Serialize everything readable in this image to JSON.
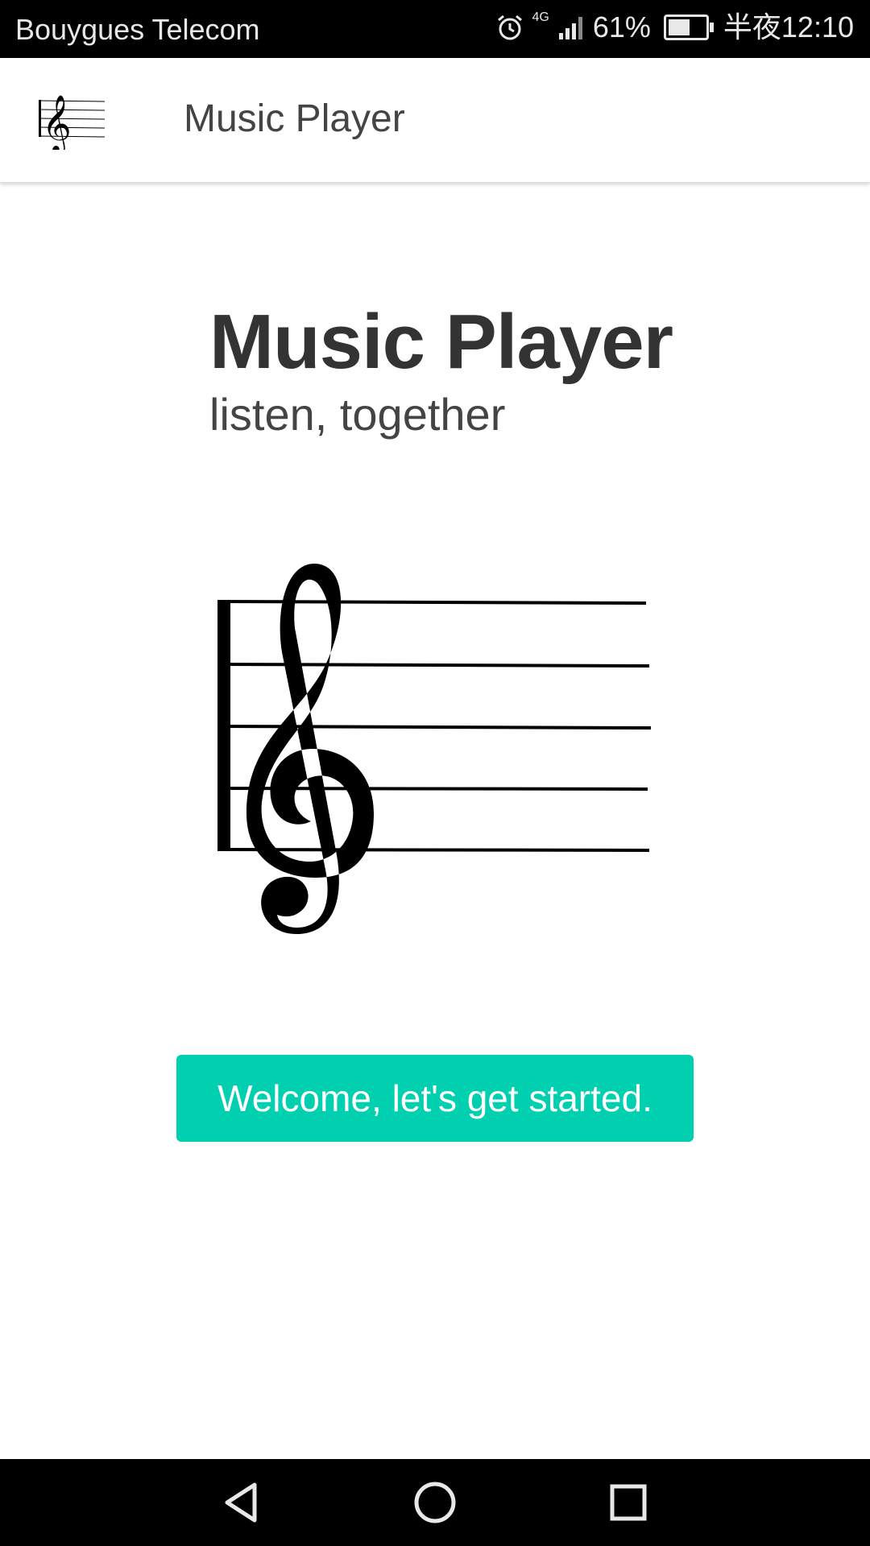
{
  "status_bar": {
    "carrier": "Bouygues Telecom",
    "network": "4G",
    "battery": "61%",
    "battery_level": 0.61,
    "time": "半夜12:10",
    "icons": [
      "alarm-icon",
      "signal-icon",
      "battery-icon"
    ]
  },
  "app_bar": {
    "title": "Music Player",
    "logo_icon": "treble-clef-icon"
  },
  "hero": {
    "title": "Music Player",
    "subtitle": "listen, together",
    "image_icon": "treble-clef-staff-icon"
  },
  "cta": {
    "label": "Welcome, let's get started.",
    "color": "#00cfb0"
  },
  "nav_bar": {
    "icons": [
      "back-icon",
      "home-icon",
      "recents-icon"
    ]
  }
}
